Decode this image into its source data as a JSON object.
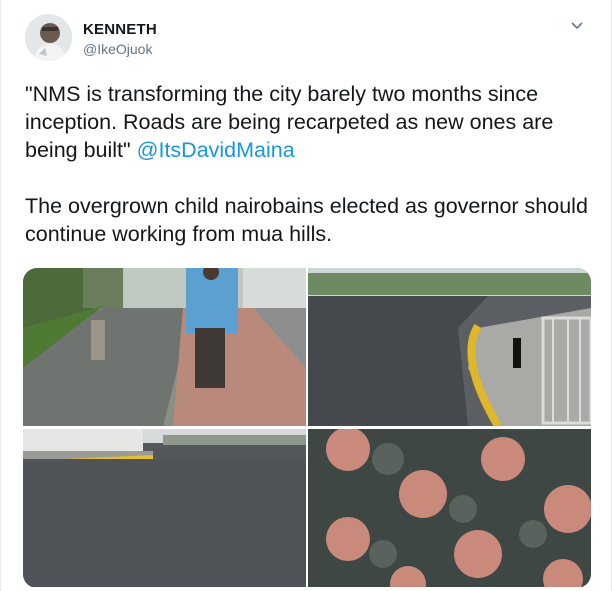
{
  "tweet": {
    "display_name": "KENNETH",
    "handle": "@IkeOjuok",
    "text_part1": "\"NMS is transforming the city barely two months since inception. Roads are being recarpeted as new ones are being built\" ",
    "mention": "@ItsDavidMaina",
    "text_part2": "\n\nThe overgrown child nairobains elected as governor should continue working from mua hills."
  },
  "icons": {
    "menu": "chevron-down-icon",
    "avatar": "user-avatar"
  },
  "colors": {
    "link": "#1b95e0",
    "secondary_text": "#657786",
    "primary_text": "#14171a"
  }
}
